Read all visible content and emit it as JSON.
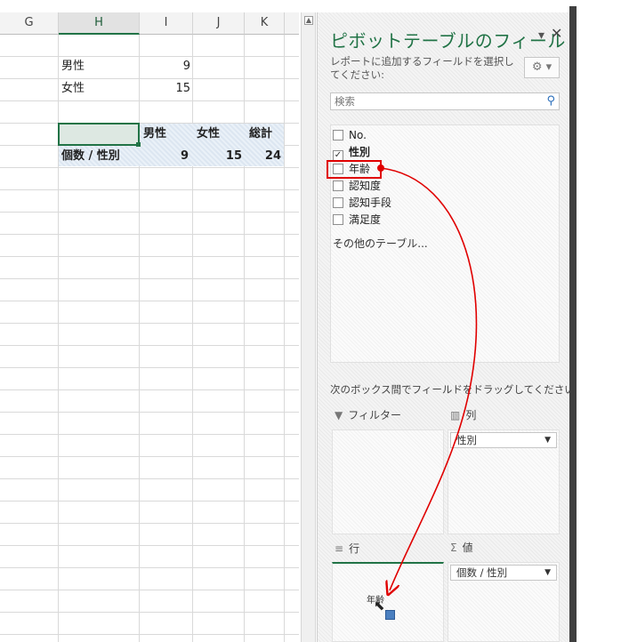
{
  "sheet": {
    "columns": [
      "G",
      "H",
      "I",
      "J",
      "K"
    ],
    "cells": {
      "male_label": "男性",
      "male_value": "9",
      "female_label": "女性",
      "female_value": "15"
    },
    "pivot": {
      "header_male": "男性",
      "header_female": "女性",
      "header_total": "総計",
      "row_label": "個数 / 性別",
      "male_count": "9",
      "female_count": "15",
      "total_count": "24"
    }
  },
  "pane": {
    "title": "ピボットテーブルのフィールド",
    "subtitle": "レポートに追加するフィールドを選択してください:",
    "search_placeholder": "検索",
    "fields": [
      {
        "label": "No.",
        "checked": false
      },
      {
        "label": "性別",
        "checked": true
      },
      {
        "label": "年齢",
        "checked": false
      },
      {
        "label": "認知度",
        "checked": false
      },
      {
        "label": "認知手段",
        "checked": false
      },
      {
        "label": "満足度",
        "checked": false
      }
    ],
    "more_tables": "その他のテーブル...",
    "drag_instruction": "次のボックス間でフィールドをドラッグしてください:",
    "areas": {
      "filter": "フィルター",
      "columns": "列",
      "rows": "行",
      "values": "値"
    },
    "columns_chip": "性別",
    "values_chip": "個数 / 性別",
    "drag_ghost_label": "年齢"
  },
  "colors": {
    "accent": "#217346",
    "highlight": "#e00000"
  }
}
